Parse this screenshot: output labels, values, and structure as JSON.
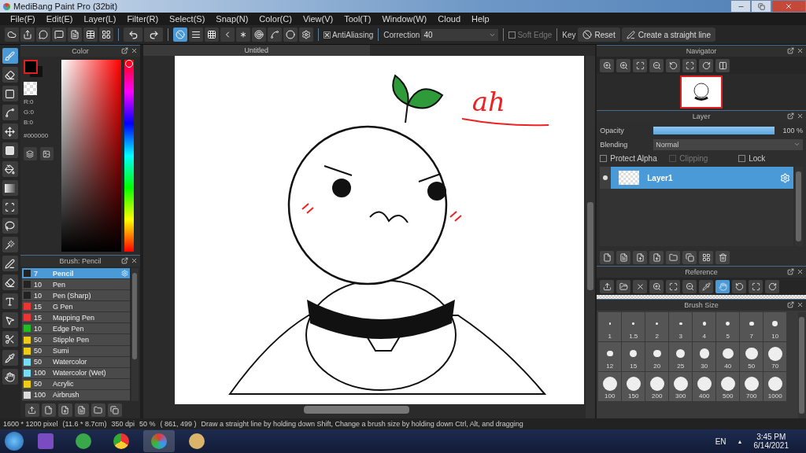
{
  "window": {
    "title": "MediBang Paint Pro (32bit)"
  },
  "menu": [
    "File(F)",
    "Edit(E)",
    "Layer(L)",
    "Filter(R)",
    "Select(S)",
    "Snap(N)",
    "Color(C)",
    "View(V)",
    "Tool(T)",
    "Window(W)",
    "Cloud",
    "Help"
  ],
  "file_tools": [
    {
      "kind": "cloud"
    },
    {
      "kind": "share"
    },
    {
      "kind": "comment"
    },
    {
      "kind": "note"
    },
    {
      "kind": "page"
    },
    {
      "kind": "table"
    },
    {
      "kind": "grid"
    }
  ],
  "history_tools": [
    {
      "kind": "undo"
    },
    {
      "kind": "redo"
    }
  ],
  "snap_modes": [
    {
      "kind": "off",
      "selected": true
    },
    {
      "kind": "parallel",
      "selected": false
    },
    {
      "kind": "cross",
      "selected": false
    },
    {
      "kind": "perspective",
      "selected": false
    },
    {
      "kind": "radial",
      "selected": false
    },
    {
      "kind": "circle",
      "selected": false
    },
    {
      "kind": "curve",
      "selected": false
    },
    {
      "kind": "ellipse",
      "selected": false
    },
    {
      "kind": "settings",
      "selected": false
    }
  ],
  "antialiasing": {
    "label": "AntiAliasing",
    "checked": true
  },
  "correction": {
    "label": "Correction",
    "value": "40"
  },
  "soft_edge": {
    "label": "Soft Edge",
    "checked": false
  },
  "key_label": "Key",
  "reset_button": "Reset",
  "straight_line_button": "Create a straight line",
  "tools": [
    {
      "kind": "brush",
      "selected": true
    },
    {
      "kind": "eraser",
      "selected": false
    },
    {
      "kind": "rect",
      "selected": false
    },
    {
      "kind": "dotline",
      "selected": false
    },
    {
      "kind": "move",
      "selected": false
    },
    {
      "kind": "fill",
      "selected": false
    },
    {
      "kind": "bucket",
      "selected": false
    },
    {
      "kind": "gradient",
      "selected": false
    },
    {
      "kind": "select",
      "selected": false
    },
    {
      "kind": "lasso",
      "selected": false
    },
    {
      "kind": "wand",
      "selected": false
    },
    {
      "kind": "selpen",
      "selected": false
    },
    {
      "kind": "selerase",
      "selected": false
    },
    {
      "kind": "text",
      "selected": false
    },
    {
      "kind": "operation",
      "selected": false
    },
    {
      "kind": "divide",
      "selected": false
    },
    {
      "kind": "eyedropper",
      "selected": false
    },
    {
      "kind": "hand",
      "selected": false
    }
  ],
  "color_panel": {
    "title": "Color",
    "hue": {
      "level": 0
    },
    "readings": [
      "R:0",
      "G:0",
      "B:0"
    ],
    "hex": "#000000"
  },
  "brush_panel": {
    "title": "Brush: Pencil",
    "brushes": [
      {
        "size": "7",
        "name": "Pencil",
        "color": "#222222",
        "selected": true
      },
      {
        "size": "10",
        "name": "Pen",
        "color": "#222222",
        "selected": false
      },
      {
        "size": "10",
        "name": "Pen (Sharp)",
        "color": "#222222",
        "selected": false
      },
      {
        "size": "15",
        "name": "G Pen",
        "color": "#ee3333",
        "selected": false
      },
      {
        "size": "15",
        "name": "Mapping Pen",
        "color": "#ee3333",
        "selected": false
      },
      {
        "size": "10",
        "name": "Edge Pen",
        "color": "#22bb22",
        "selected": false
      },
      {
        "size": "50",
        "name": "Stipple Pen",
        "color": "#eecc11",
        "selected": false
      },
      {
        "size": "50",
        "name": "Sumi",
        "color": "#eecc11",
        "selected": false
      },
      {
        "size": "50",
        "name": "Watercolor",
        "color": "#77ddf5",
        "selected": false
      },
      {
        "size": "100",
        "name": "Watercolor (Wet)",
        "color": "#77ddf5",
        "selected": false
      },
      {
        "size": "50",
        "name": "Acrylic",
        "color": "#eecc11",
        "selected": false
      },
      {
        "size": "100",
        "name": "Airbrush",
        "color": "#dddddd",
        "selected": false
      }
    ]
  },
  "canvas": {
    "tab": "Untitled",
    "note": "ah"
  },
  "navigator": {
    "title": "Navigator"
  },
  "layer_panel": {
    "title": "Layer",
    "opacity_label": "Opacity",
    "opacity": {
      "level": 1
    },
    "opacity_reading": "100 %",
    "blending_label": "Blending",
    "blending": "Normal",
    "options": [
      {
        "label": "Protect Alpha",
        "checked": false,
        "disabled": false
      },
      {
        "label": "Clipping",
        "checked": false,
        "disabled": true
      },
      {
        "label": "Lock",
        "checked": false,
        "disabled": false
      }
    ],
    "layers": [
      {
        "name": "Layer1",
        "selected": true
      }
    ]
  },
  "reference": {
    "title": "Reference"
  },
  "brush_size": {
    "title": "Brush Size",
    "sizes": [
      "1",
      "1.5",
      "2",
      "3",
      "4",
      "5",
      "7",
      "10",
      "12",
      "15",
      "20",
      "25",
      "30",
      "40",
      "50",
      "70",
      "100",
      "150",
      "200",
      "300",
      "400",
      "500",
      "700",
      "1000"
    ]
  },
  "status_bar": [
    "1600 * 1200 pixel",
    "(11.6 * 8.7cm)",
    "350 dpi",
    "50 %",
    "( 861, 499 )",
    "Draw a straight line by holding down Shift, Change a brush size by holding down Ctrl, Alt, and dragging"
  ],
  "taskbar": {
    "language": "EN",
    "tray_arrow": "▲",
    "time": "3:45 PM",
    "date": "6/14/2021"
  }
}
